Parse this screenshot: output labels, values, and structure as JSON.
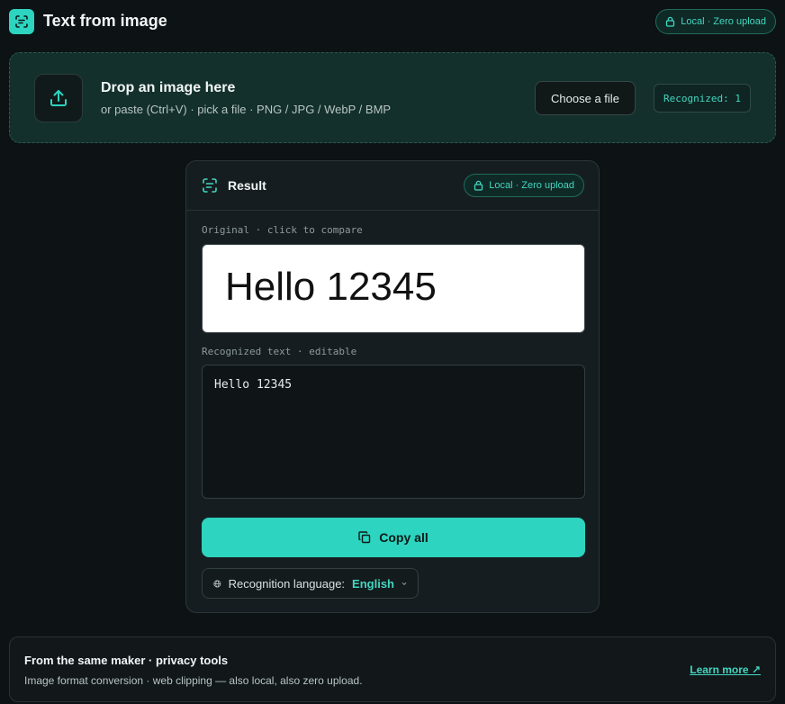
{
  "header": {
    "title": "Text from image",
    "logo_icon": "scan-text-icon",
    "privacy_badge": "Local · Zero upload"
  },
  "dropzone": {
    "title": "Drop an image here",
    "subtitle": "or paste (Ctrl+V) · pick a file · PNG / JPG / WebP / BMP",
    "choose_button": "Choose a file",
    "recognized_count": "Recognized: 1",
    "icon": "upload-icon"
  },
  "result": {
    "title": "Result",
    "privacy_badge": "Local · Zero upload",
    "original_label": "Original · click to compare",
    "original_image_text": "Hello 12345",
    "recognized_label": "Recognized text · editable",
    "recognized_text": "Hello 12345",
    "copy_button": "Copy all",
    "language_label": "Recognition language:",
    "language_value": "English"
  },
  "footer": {
    "title": "From the same maker · privacy tools",
    "subtitle": "Image format conversion · web clipping — also local, also zero upload.",
    "link": "Learn more ↗"
  },
  "colors": {
    "accent": "#2dd4bf",
    "background": "#0d1214",
    "dropzone_bg": "#13302c"
  }
}
